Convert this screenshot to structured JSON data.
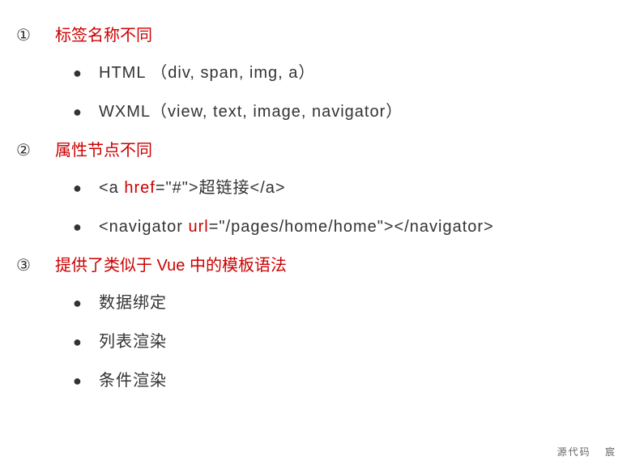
{
  "sections": [
    {
      "marker": "①",
      "heading": "标签名称不同",
      "items": [
        {
          "type": "plain",
          "text": "HTML （div, span, img, a）"
        },
        {
          "type": "plain",
          "text": "WXML（view, text, image, navigator）"
        }
      ]
    },
    {
      "marker": "②",
      "heading": "属性节点不同",
      "items": [
        {
          "type": "code",
          "pre": "<a ",
          "attr": "href",
          "post": "=\"#\">超链接</a>"
        },
        {
          "type": "code",
          "pre": "<navigator ",
          "attr": "url",
          "post": "=\"/pages/home/home\"></navigator>"
        }
      ]
    },
    {
      "marker": "③",
      "heading": "提供了类似于 Vue 中的模板语法",
      "items": [
        {
          "type": "plain",
          "text": "数据绑定"
        },
        {
          "type": "plain",
          "text": "列表渲染"
        },
        {
          "type": "plain",
          "text": "条件渲染"
        }
      ]
    }
  ],
  "bullet": "●",
  "watermark": {
    "left": "源代码",
    "right": "宸"
  }
}
